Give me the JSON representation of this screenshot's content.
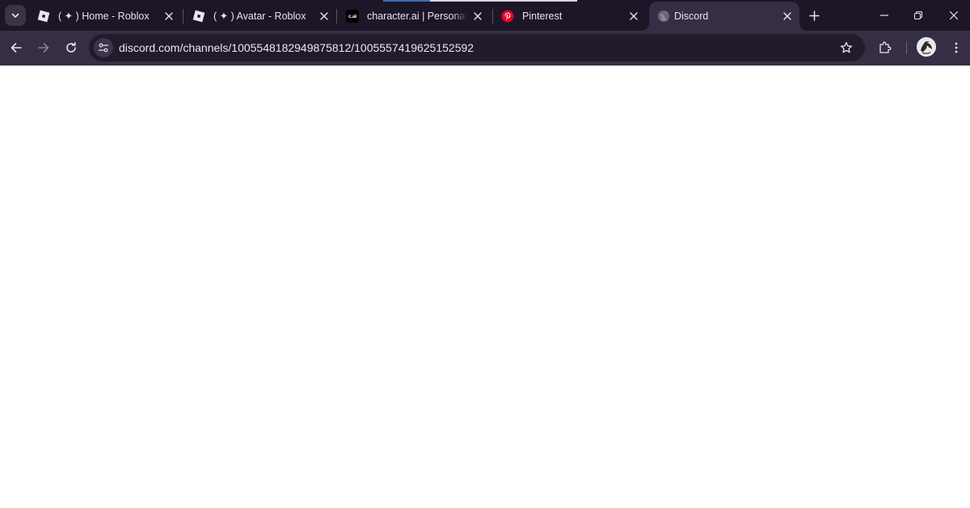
{
  "browser": {
    "tabs": [
      {
        "title": "( ✦ ) Home - Roblox",
        "icon": "roblox-icon",
        "active": false
      },
      {
        "title": "( ✦ ) Avatar - Roblox",
        "icon": "roblox-icon",
        "active": false
      },
      {
        "title": "character.ai | Personalized",
        "icon": "character-ai-icon",
        "favicon_text": "c.ai",
        "active": false
      },
      {
        "title": "Pinterest",
        "icon": "pinterest-icon",
        "active": false
      },
      {
        "title": "Discord",
        "icon": "globe-icon",
        "active": true
      }
    ],
    "address_bar": {
      "url": "discord.com/channels/1005548182949875812/1005557419625152592"
    },
    "colors": {
      "tabstrip": "#1c1626",
      "toolbar": "#352e44",
      "omnibox": "#221b2c",
      "text": "#e9e4f0",
      "pinterest": "#e60023",
      "loading_bar": "#3e6db8"
    }
  }
}
